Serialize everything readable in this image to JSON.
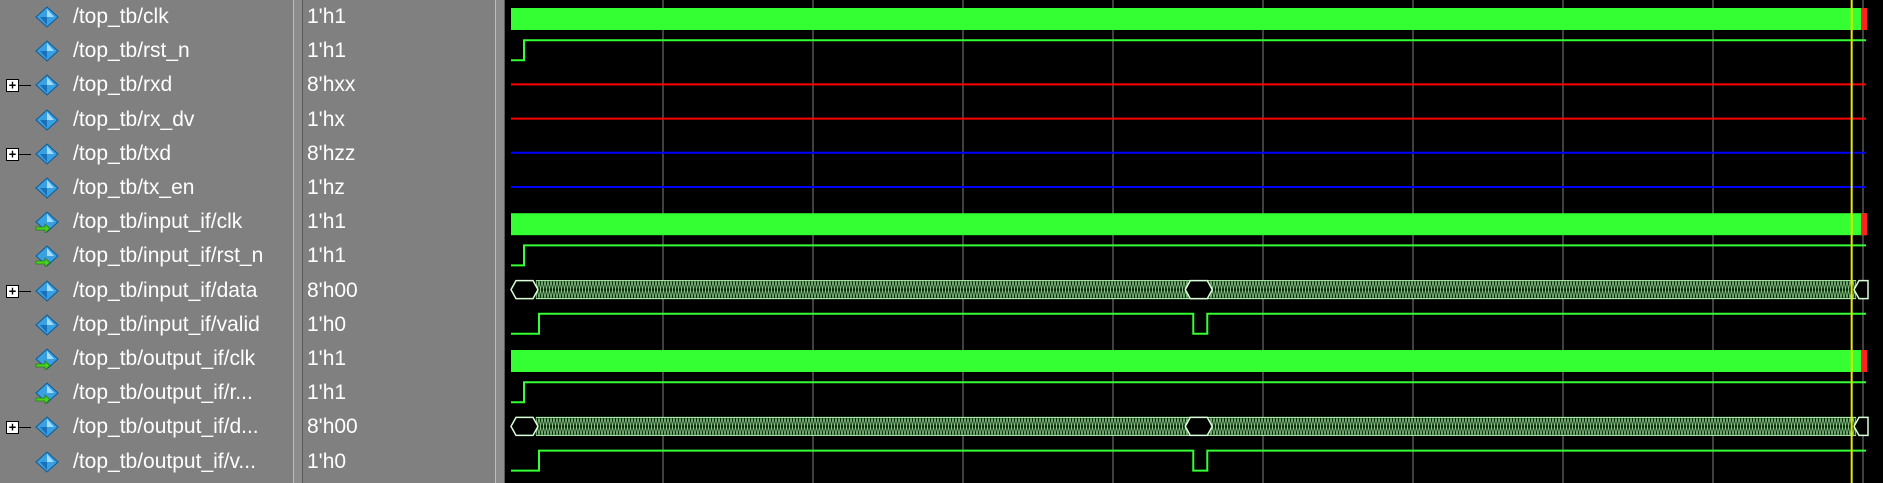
{
  "signals": [
    {
      "name": "/top_tb/clk",
      "value": "1'h1",
      "kind": "clk",
      "expandable": false,
      "icon": "signal-icon"
    },
    {
      "name": "/top_tb/rst_n",
      "value": "1'h1",
      "kind": "reset",
      "expandable": false,
      "icon": "signal-icon"
    },
    {
      "name": "/top_tb/rxd",
      "value": "8'hxx",
      "kind": "x",
      "expandable": true,
      "icon": "signal-icon"
    },
    {
      "name": "/top_tb/rx_dv",
      "value": "1'hx",
      "kind": "x",
      "expandable": false,
      "icon": "signal-icon"
    },
    {
      "name": "/top_tb/txd",
      "value": "8'hzz",
      "kind": "z",
      "expandable": true,
      "icon": "signal-icon"
    },
    {
      "name": "/top_tb/tx_en",
      "value": "1'hz",
      "kind": "z",
      "expandable": false,
      "icon": "signal-icon"
    },
    {
      "name": "/top_tb/input_if/clk",
      "value": "1'h1",
      "kind": "clk",
      "expandable": false,
      "icon": "interface-signal-icon"
    },
    {
      "name": "/top_tb/input_if/rst_n",
      "value": "1'h1",
      "kind": "reset",
      "expandable": false,
      "icon": "interface-signal-icon"
    },
    {
      "name": "/top_tb/input_if/data",
      "value": "8'h00",
      "kind": "bus",
      "expandable": true,
      "icon": "signal-icon"
    },
    {
      "name": "/top_tb/input_if/valid",
      "value": "1'h0",
      "kind": "valid",
      "expandable": false,
      "icon": "signal-icon"
    },
    {
      "name": "/top_tb/output_if/clk",
      "value": "1'h1",
      "kind": "clk",
      "expandable": false,
      "icon": "interface-signal-icon"
    },
    {
      "name": "/top_tb/output_if/r...",
      "value": "1'h1",
      "kind": "reset",
      "expandable": false,
      "icon": "interface-signal-icon"
    },
    {
      "name": "/top_tb/output_if/d...",
      "value": "8'h00",
      "kind": "bus",
      "expandable": true,
      "icon": "signal-icon"
    },
    {
      "name": "/top_tb/output_if/v...",
      "value": "1'h0",
      "kind": "valid",
      "expandable": false,
      "icon": "signal-icon"
    }
  ],
  "colors": {
    "wave_active": "#33ff33",
    "wave_x": "#ff0000",
    "wave_z": "#0000ff",
    "grid": "#808080",
    "cursor": "#e8e800",
    "cursor_marker": "#ff2020",
    "background": "#000000"
  },
  "waveform": {
    "grid_divisions": 9,
    "valid_low_pulse_fraction": 0.505,
    "cursor_fraction": 0.985
  }
}
